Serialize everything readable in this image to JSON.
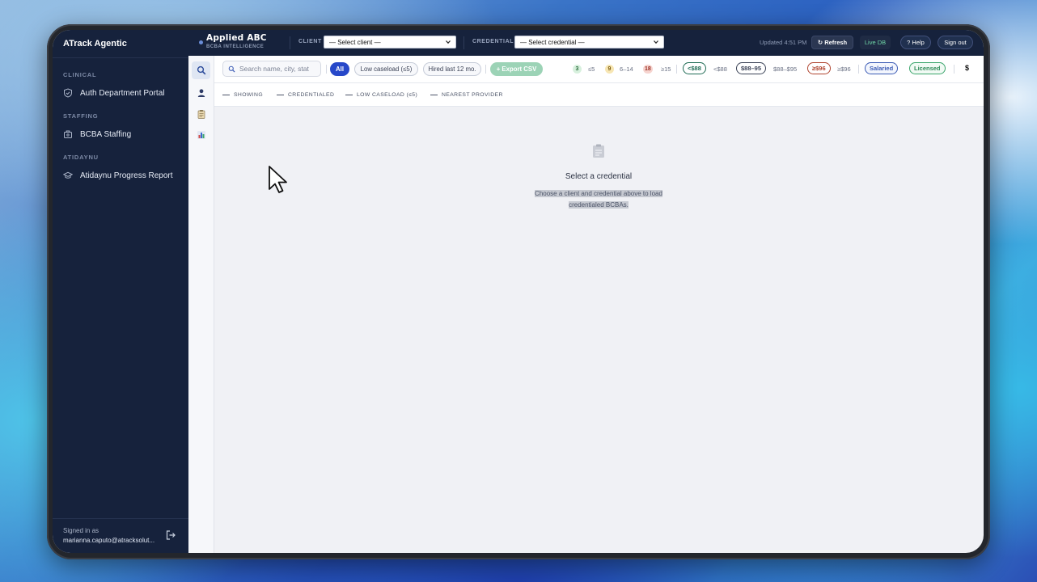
{
  "sidebar": {
    "brand": "ATrack Agentic",
    "sections": [
      {
        "label": "CLINICAL",
        "item": "Auth Department Portal"
      },
      {
        "label": "STAFFING",
        "item": "BCBA Staffing"
      },
      {
        "label": "ATIDAYNU",
        "item": "Atidaynu Progress Report"
      }
    ],
    "signed_in_label": "Signed in as",
    "email": "marianna.caputo@atracksolut..."
  },
  "topbar": {
    "logo_title": "Applied ABC",
    "logo_subtitle": "BCBA INTELLIGENCE",
    "client_label": "CLIENT",
    "client_value": "— Select client —",
    "credential_label": "CREDENTIAL",
    "credential_value": "— Select credential —",
    "updated": "Updated 4:51 PM",
    "refresh": "↻ Refresh",
    "live_db": "Live DB",
    "help": "? Help",
    "sign_out": "Sign out"
  },
  "filters": {
    "search_placeholder": "Search name, city, stat",
    "all": "All",
    "low_caseload": "Low caseload (≤5)",
    "hired_last": "Hired last 12 mo.",
    "export": "+ Export CSV",
    "caseload_legend": [
      {
        "badge": "3",
        "text": "≤5",
        "color": "#d7f0dd",
        "fg": "#2c6b3d"
      },
      {
        "badge": "9",
        "text": "6–14",
        "color": "#f7e6b3",
        "fg": "#7a5a0f"
      },
      {
        "badge": "18",
        "text": "≥15",
        "color": "#f6d4cf",
        "fg": "#9a2f23"
      }
    ],
    "rates": [
      {
        "chip": "<$88",
        "text": "<$88",
        "border": "#1f6b54",
        "fg": "#1f6b54"
      },
      {
        "chip": "$88–95",
        "text": "$88–$95",
        "border": "#3a4256",
        "fg": "#3a4256"
      },
      {
        "chip": "≥$96",
        "text": "≥$96",
        "border": "#b0442f",
        "fg": "#b0442f"
      }
    ],
    "salaried": "Salaried",
    "licensed": "Licensed",
    "dollar": "$"
  },
  "subbar": {
    "showing": "SHOWING",
    "credentialed": "CREDENTIALED",
    "low_caseload": "LOW CASELOAD (≤5)",
    "nearest": "NEAREST PROVIDER"
  },
  "empty_state": {
    "title": "Select a credential",
    "line1": "Choose a client and credential above to load",
    "line2": "credentialed BCBAs."
  }
}
